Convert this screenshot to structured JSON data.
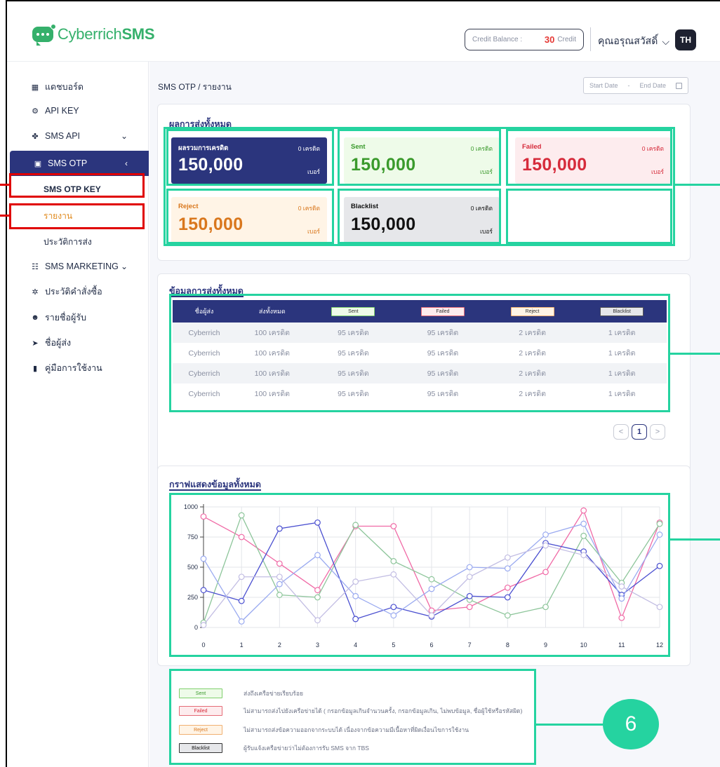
{
  "header": {
    "logo_part1": "Cyberrich",
    "logo_part2": "SMS",
    "credit_label": "Credit Balance :",
    "credit_value": "30",
    "credit_unit": "Credit",
    "user_name": "คุณอรุณสวัสดิ์",
    "avatar_initials": "TH"
  },
  "sidebar": {
    "items": [
      {
        "label": "แดชบอร์ด",
        "icon": "dashboard-icon"
      },
      {
        "label": "API KEY",
        "icon": "api-key-icon"
      },
      {
        "label": "SMS API",
        "icon": "sms-api-icon"
      },
      {
        "label": "SMS OTP",
        "icon": "sms-otp-icon"
      },
      {
        "label": "SMS MARKETING",
        "icon": "sms-marketing-icon"
      },
      {
        "label": "ประวัติคำสั่งซื้อ",
        "icon": "order-history-icon"
      },
      {
        "label": "รายชื่อผู้รับ",
        "icon": "recipients-icon"
      },
      {
        "label": "ชื่อผู้ส่ง",
        "icon": "sender-icon"
      },
      {
        "label": "คู่มือการใช้งาน",
        "icon": "manual-icon"
      }
    ],
    "otp_sub": [
      "SMS OTP KEY",
      "รายงาน",
      "ประวัติการส่ง"
    ]
  },
  "main": {
    "breadcrumb": "SMS OTP / รายงาน",
    "start_date": "Start Date",
    "date_sep": "-",
    "end_date": "End Date"
  },
  "summary": {
    "title": "ผลการส่งทั้งหมด",
    "cards": [
      {
        "label": "ผลรวมการเครดิต",
        "credit": "0 เครดิต",
        "value": "150,000",
        "unit": "เบอร์"
      },
      {
        "label": "Sent",
        "credit": "0 เครดิต",
        "value": "150,000",
        "unit": "เบอร์"
      },
      {
        "label": "Failed",
        "credit": "0 เครดิต",
        "value": "150,000",
        "unit": "เบอร์"
      },
      {
        "label": "Reject",
        "credit": "0 เครดิต",
        "value": "150,000",
        "unit": "เบอร์"
      },
      {
        "label": "Blacklist",
        "credit": "0 เครดิต",
        "value": "150,000",
        "unit": "เบอร์"
      }
    ]
  },
  "table": {
    "title": "ข้อมูลการส่งทั้งหมด",
    "headers": [
      "ชื่อผู้ส่ง",
      "ส่งทั้งหมด",
      "Sent",
      "Failed",
      "Reject",
      "Blacklist"
    ],
    "rows": [
      [
        "Cyberrich",
        "100 เครดิต",
        "95 เครดิต",
        "95 เครดิต",
        "2 เครดิต",
        "1 เครดิต"
      ],
      [
        "Cyberrich",
        "100 เครดิต",
        "95 เครดิต",
        "95 เครดิต",
        "2 เครดิต",
        "1 เครดิต"
      ],
      [
        "Cyberrich",
        "100 เครดิต",
        "95 เครดิต",
        "95 เครดิต",
        "2 เครดิต",
        "1 เครดิต"
      ],
      [
        "Cyberrich",
        "100 เครดิต",
        "95 เครดิต",
        "95 เครดิต",
        "2 เครดิต",
        "1 เครดิต"
      ]
    ],
    "page_prev": "<",
    "page_current": "1",
    "page_next": ">"
  },
  "chart_title": "กราฟแสดงข้อมูลทั้งหมด",
  "chart_data": {
    "type": "line",
    "x": [
      0,
      1,
      2,
      3,
      4,
      5,
      6,
      7,
      8,
      9,
      10,
      11,
      12
    ],
    "ylim": [
      0,
      1000
    ],
    "yticks": [
      0,
      250,
      500,
      750,
      1000
    ],
    "grid": true,
    "series": [
      {
        "color": "#f06aa6",
        "values": [
          920,
          750,
          530,
          310,
          840,
          840,
          140,
          170,
          330,
          460,
          970,
          80,
          870
        ]
      },
      {
        "color": "#8dc59a",
        "values": [
          40,
          930,
          270,
          250,
          850,
          550,
          400,
          230,
          100,
          170,
          760,
          370,
          860
        ]
      },
      {
        "color": "#4a4fd0",
        "values": [
          310,
          220,
          820,
          870,
          70,
          170,
          90,
          260,
          250,
          700,
          630,
          270,
          510
        ]
      },
      {
        "color": "#9aaaf0",
        "values": [
          570,
          50,
          360,
          600,
          260,
          100,
          320,
          500,
          490,
          770,
          860,
          240,
          770
        ]
      },
      {
        "color": "#c2bde3",
        "values": [
          20,
          420,
          420,
          60,
          380,
          440,
          100,
          420,
          580,
          680,
          600,
          340,
          170
        ]
      }
    ]
  },
  "legend": [
    {
      "label": "Sent",
      "desc": "ส่งถึงเครือข่ายเรียบร้อย"
    },
    {
      "label": "Failed",
      "desc": "ไม่สามารถส่งไปยังเครือข่ายได้ ( กรอกข้อมูลเกินจำนวนครั้ง, กรอกข้อมูลเกิน, ไม่พบข้อมูล, ชื่อผู้ใช้หรือรหัสผิด)"
    },
    {
      "label": "Reject",
      "desc": "ไม่สามารถส่งข้อความออกจากระบบได้ เนื่องจากข้อความมีเนื้อหาที่ผิดเงื่อนไขการใช้งาน"
    },
    {
      "label": "Blacklist",
      "desc": "ผู้รับแจ้งเครือข่ายว่าไม่ต้องการรับ SMS จาก TBS"
    }
  ],
  "badge": "6",
  "colors": {
    "navy": "#2b357d",
    "teal_annotation": "#25d3a0",
    "red_annotation": "#e00000",
    "sent_green": "#3a9a2c",
    "failed_red": "#d62b3b",
    "reject_orange": "#d9771d"
  }
}
